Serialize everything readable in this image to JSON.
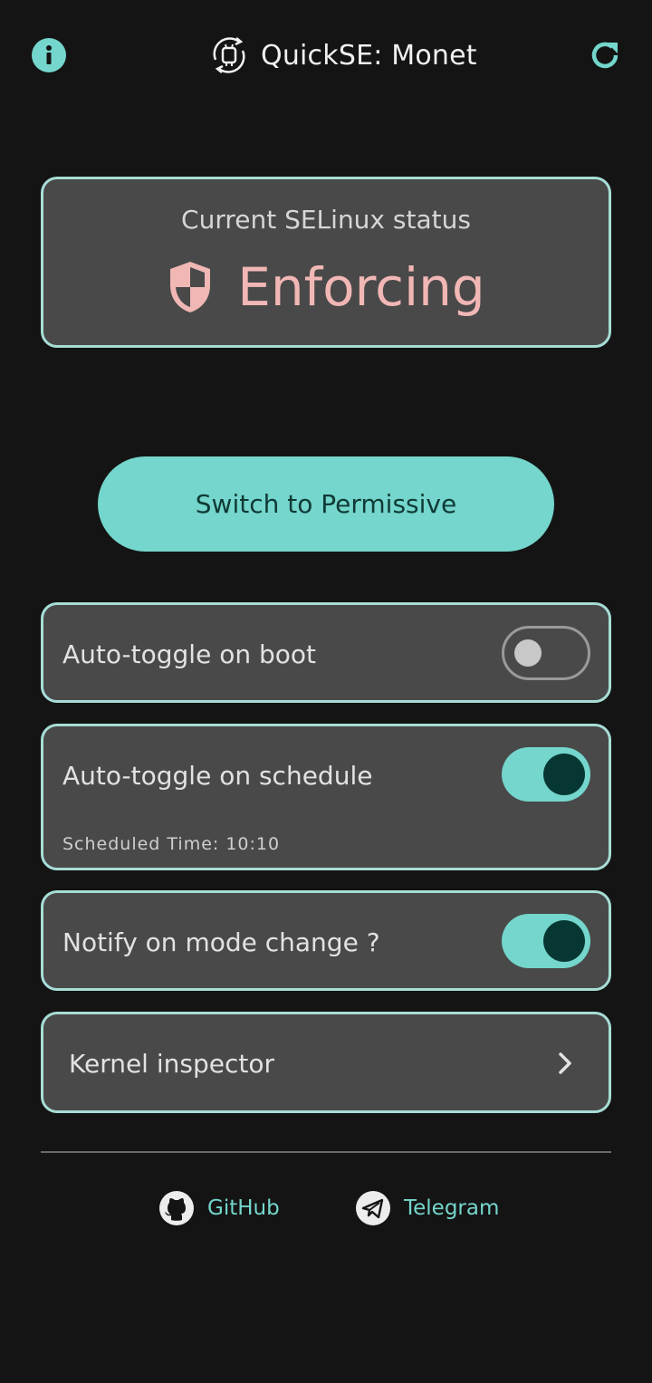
{
  "header": {
    "title": "QuickSE: Monet",
    "info_icon": "info-icon",
    "refresh_icon": "refresh-icon",
    "logo_icon": "app-logo-icon"
  },
  "status": {
    "label": "Current SELinux status",
    "value": "Enforcing",
    "icon": "shield-icon"
  },
  "primary_action": {
    "label": "Switch to Permissive"
  },
  "settings": [
    {
      "label": "Auto-toggle on boot",
      "enabled": false
    },
    {
      "label": "Auto-toggle on schedule",
      "enabled": true,
      "sub": "Scheduled Time: 10:10"
    },
    {
      "label": "Notify on mode change ?",
      "enabled": true
    }
  ],
  "kernel_inspector": {
    "label": "Kernel inspector",
    "icon": "chevron-right-icon"
  },
  "footer": {
    "github": {
      "label": "GitHub",
      "icon": "github-icon"
    },
    "telegram": {
      "label": "Telegram",
      "icon": "telegram-icon"
    }
  },
  "colors": {
    "background": "#141414",
    "card": "#494949",
    "card_border": "#a7ddd6",
    "accent": "#74d6cc",
    "status_text": "#f1b7b5",
    "button_text": "#0f3a36"
  }
}
